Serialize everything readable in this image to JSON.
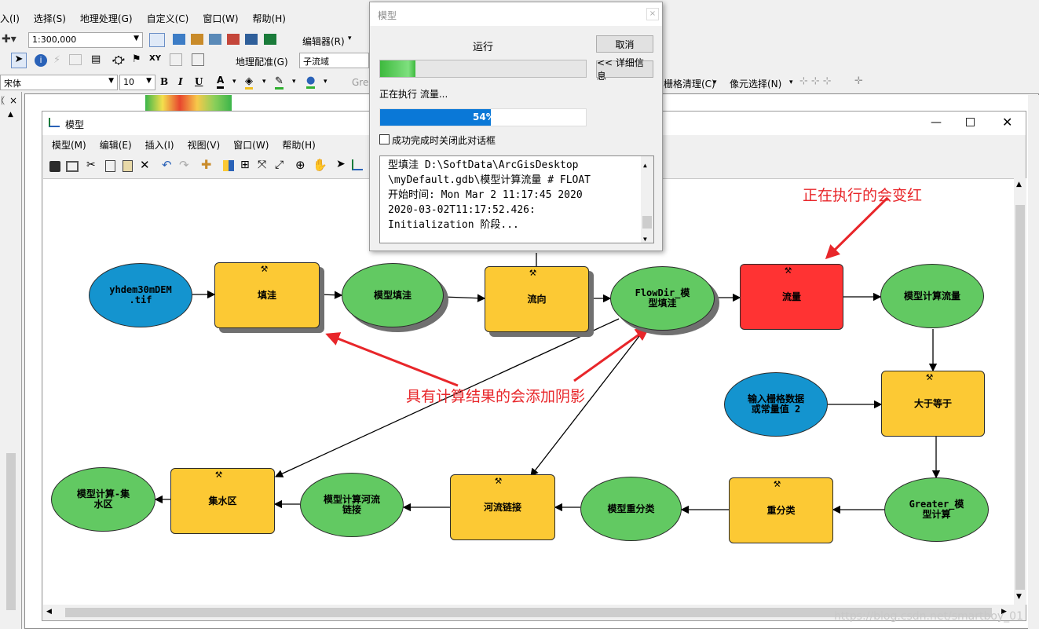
{
  "app": {
    "menus": [
      "入(I)",
      "选择(S)",
      "地理处理(G)",
      "自定义(C)",
      "窗口(W)",
      "帮助(H)"
    ],
    "scale": "1:300,000",
    "editor_label": "编辑器(R)",
    "georef_label": "地理配准(G)",
    "georef_layer": "子流域",
    "font_name": "宋体",
    "font_size": "10",
    "gre_label": "Gre",
    "raster_cleanup": "栅格清理(C)",
    "pixel_select": "像元选择(N)"
  },
  "model_window": {
    "title": "模型",
    "menus": [
      "模型(M)",
      "编辑(E)",
      "插入(I)",
      "视图(V)",
      "窗口(W)",
      "帮助(H)"
    ]
  },
  "diagram": {
    "nodes": {
      "yhdem": "yhdem30mDEM\n.tif",
      "fill": "填洼",
      "fill_out": "模型填洼",
      "flowdir": "流向",
      "flowdir_out": "FlowDir_模\n型填洼",
      "flowacc": "流量",
      "flowacc_out": "模型计算流量",
      "const_in": "输入栅格数据\n或常量值 2",
      "gte": "大于等于",
      "gte_out": "Greater_模\n型计算",
      "reclass": "重分类",
      "reclass_out": "模型重分类",
      "streamlink": "河流链接",
      "streamlink_out": "模型计算河流\n链接",
      "watershed": "集水区",
      "watershed_out": "模型计算-集\n水区"
    },
    "annotations": {
      "red": "正在执行的会变红",
      "shadow": "具有计算结果的会添加阴影"
    },
    "colors": {
      "input": "#1494cf",
      "output": "#62c962",
      "tool": "#fcc934",
      "running": "#ff3333",
      "annotation": "#e8262a"
    }
  },
  "dialog": {
    "title": "模型",
    "status": "运行",
    "cancel": "取消",
    "details": "<< 详细信息",
    "executing": "正在执行 流量...",
    "top_progress": 0.17,
    "percent_label": "54%",
    "percent": 0.54,
    "checkbox": "成功完成时关闭此对话框",
    "log": [
      "型填洼 D:\\SoftData\\ArcGisDesktop",
      "\\myDefault.gdb\\模型计算流量 # FLOAT",
      "开始时间: Mon Mar  2 11:17:45 2020",
      "2020-03-02T11:17:52.426:",
      "Initialization 阶段..."
    ]
  },
  "watermark": "https://blog.csdn.net/smartboy_01"
}
